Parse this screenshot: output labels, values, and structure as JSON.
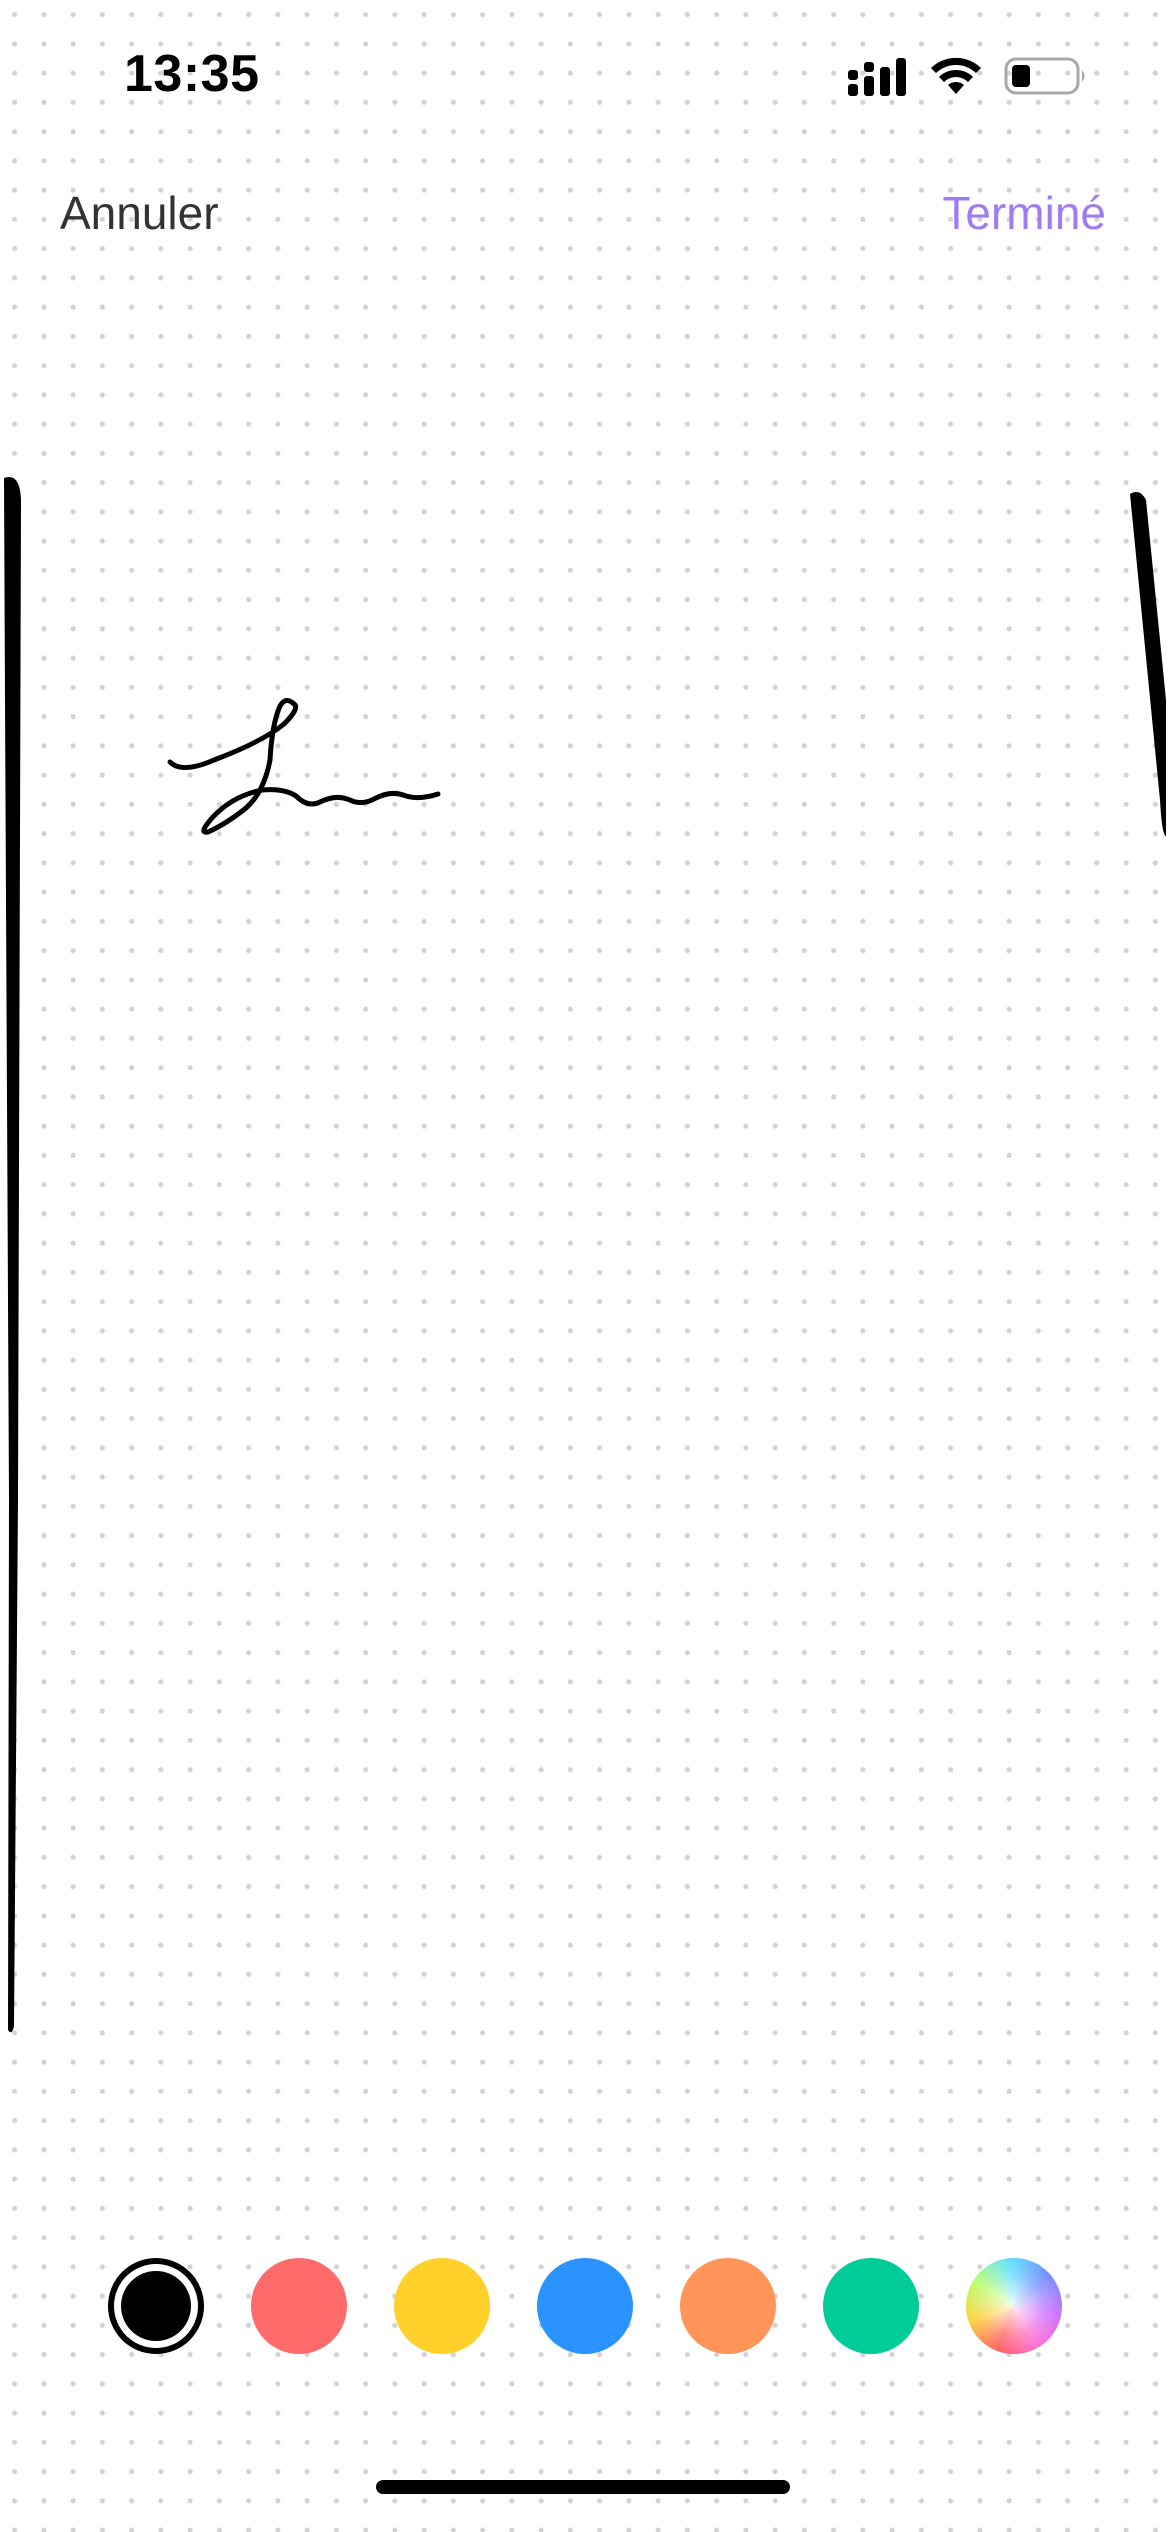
{
  "status_bar": {
    "time": "13:35",
    "icons": [
      "cellular-signal-icon",
      "wifi-icon",
      "battery-icon"
    ]
  },
  "nav": {
    "cancel_label": "Annuler",
    "done_label": "Terminé",
    "done_color": "#a07cf2"
  },
  "drawing": {
    "stroke_color": "#000000",
    "strokes": [
      "left-edge-stroke",
      "signature-stroke",
      "right-edge-stroke"
    ]
  },
  "palette": {
    "selected": "black",
    "colors": [
      {
        "name": "black",
        "hex": "#000000"
      },
      {
        "name": "red",
        "hex": "#ff6b6b"
      },
      {
        "name": "yellow",
        "hex": "#ffd12a"
      },
      {
        "name": "blue",
        "hex": "#2a93ff"
      },
      {
        "name": "orange",
        "hex": "#ff9558"
      },
      {
        "name": "green",
        "hex": "#00cc9a"
      },
      {
        "name": "custom",
        "hex": "rainbow"
      }
    ]
  }
}
